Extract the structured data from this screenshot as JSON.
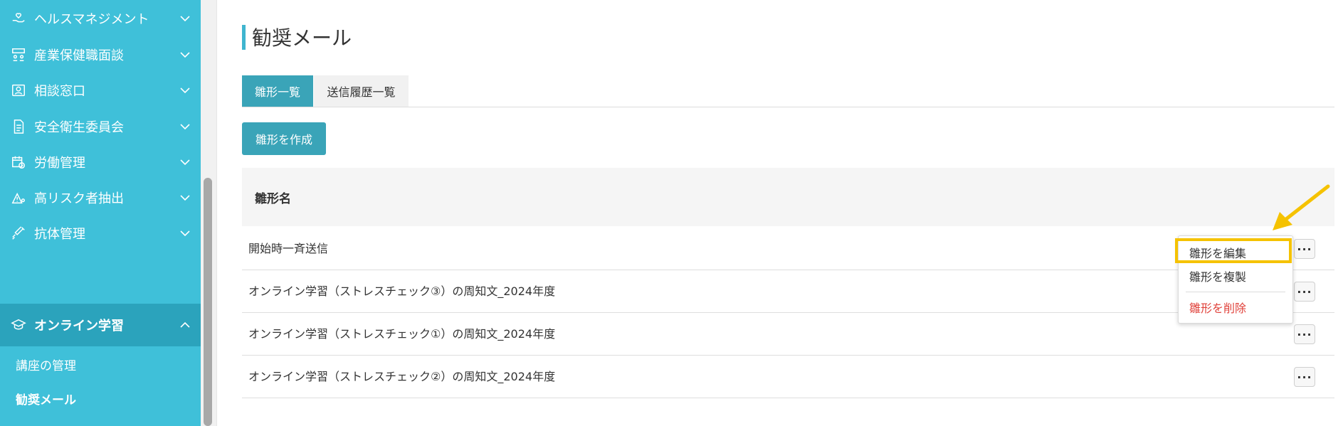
{
  "sidebar": {
    "items": [
      {
        "label": "ヘルスマネジメント",
        "icon": "hand-heart-icon"
      },
      {
        "label": "産業保健職面談",
        "icon": "people-meeting-icon"
      },
      {
        "label": "相談窓口",
        "icon": "contact-card-icon"
      },
      {
        "label": "安全衛生委員会",
        "icon": "document-icon"
      },
      {
        "label": "労働管理",
        "icon": "calendar-clock-icon"
      },
      {
        "label": "高リスク者抽出",
        "icon": "warning-person-icon"
      },
      {
        "label": "抗体管理",
        "icon": "syringe-icon"
      },
      {
        "label": "オンライン学習",
        "icon": "graduation-cap-icon"
      }
    ],
    "sub_items": [
      {
        "label": "講座の管理"
      },
      {
        "label": "勧奨メール"
      }
    ]
  },
  "page": {
    "title": "勧奨メール"
  },
  "tabs": [
    {
      "label": "雛形一覧"
    },
    {
      "label": "送信履歴一覧"
    }
  ],
  "create_button": "雛形を作成",
  "table": {
    "header": "雛形名",
    "rows": [
      {
        "name": "開始時一斉送信"
      },
      {
        "name": "オンライン学習（ストレスチェック③）の周知文_2024年度"
      },
      {
        "name": "オンライン学習（ストレスチェック①）の周知文_2024年度"
      },
      {
        "name": "オンライン学習（ストレスチェック②）の周知文_2024年度"
      }
    ],
    "more_label": "···"
  },
  "menu": {
    "edit": "雛形を編集",
    "duplicate": "雛形を複製",
    "delete": "雛形を削除"
  },
  "colors": {
    "sidebar": "#3fc0d9",
    "sidebar_active": "#2ba3bc",
    "primary": "#3aa4b8",
    "danger": "#e0413a",
    "highlight": "#f5c200"
  }
}
